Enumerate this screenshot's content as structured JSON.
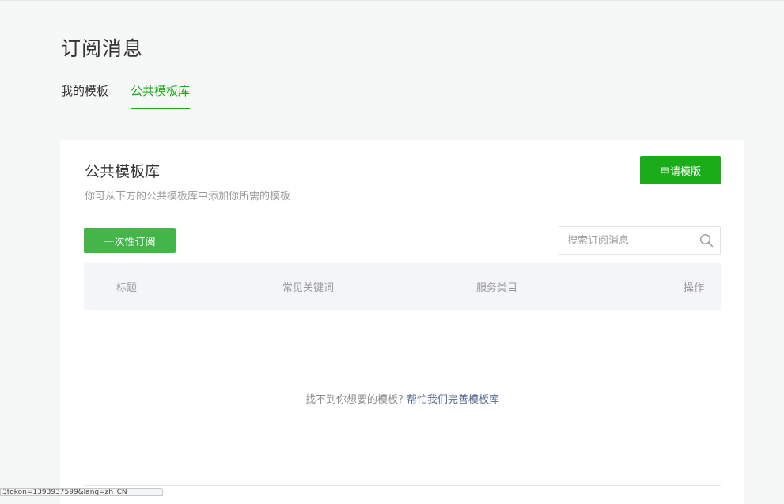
{
  "page": {
    "title": "订阅消息"
  },
  "tabs": [
    {
      "label": "我的模板",
      "active": false
    },
    {
      "label": "公共模板库",
      "active": true
    }
  ],
  "library": {
    "title": "公共模板库",
    "description": "你可从下方的公共模板库中添加你所需的模板",
    "apply_label": "申请模版",
    "filter_label": "一次性订阅",
    "search": {
      "placeholder": "搜索订阅消息",
      "value": "",
      "icon": "search-icon"
    },
    "columns": [
      "标题",
      "常见关键词",
      "服务类目",
      "操作"
    ],
    "empty": {
      "text": "找不到你想要的模板?",
      "link": "帮忙我们完善模板库"
    }
  },
  "status_bar": {
    "url": "3tokon=1393937599&lang=zh_CN"
  },
  "colors": {
    "accent": "#1aad19",
    "button_green": "#44b549",
    "link": "#576b95",
    "background": "#f6f7f7"
  }
}
